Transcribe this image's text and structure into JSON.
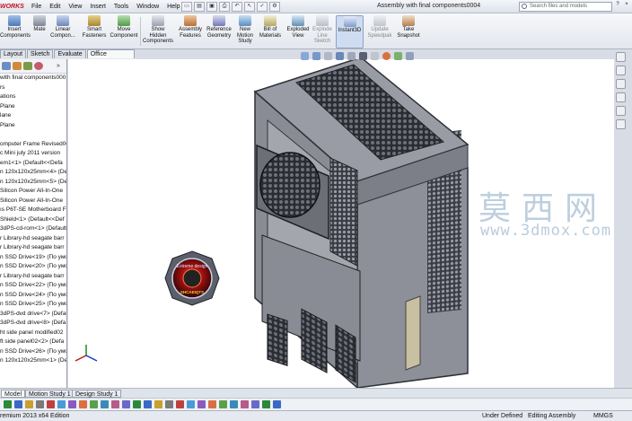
{
  "title_bar": {
    "logo": "WORKS",
    "menus": [
      "File",
      "Edit",
      "View",
      "Insert",
      "Tools",
      "Window",
      "Help"
    ],
    "document_title": "Assembly with final components0004",
    "search_placeholder": "Search files and models",
    "window_buttons": [
      "?",
      "×"
    ]
  },
  "command_manager": {
    "buttons": [
      {
        "label": "Insert\nComponents",
        "icon": "insert-components-icon",
        "enabled": true
      },
      {
        "label": "Mate",
        "icon": "mate-icon",
        "enabled": true
      },
      {
        "label": "Linear\nCompon...",
        "icon": "linear-pattern-icon",
        "enabled": true
      },
      {
        "label": "Smart\nFasteners",
        "icon": "smart-fasteners-icon",
        "enabled": true
      },
      {
        "label": "Move\nComponent",
        "icon": "move-component-icon",
        "enabled": true
      },
      {
        "label": "Show\nHidden\nComponents",
        "icon": "show-hidden-icon",
        "enabled": true
      },
      {
        "label": "Assembly\nFeatures",
        "icon": "assembly-features-icon",
        "enabled": true
      },
      {
        "label": "Reference\nGeometry",
        "icon": "reference-geometry-icon",
        "enabled": true
      },
      {
        "label": "New\nMotion\nStudy",
        "icon": "new-motion-study-icon",
        "enabled": true
      },
      {
        "label": "Bill of\nMaterials",
        "icon": "bill-of-materials-icon",
        "enabled": true
      },
      {
        "label": "Exploded\nView",
        "icon": "exploded-view-icon",
        "enabled": true
      },
      {
        "label": "Explode\nLine\nSketch",
        "icon": "explode-line-sketch-icon",
        "enabled": false
      },
      {
        "label": "Instant3D",
        "icon": "instant3d-icon",
        "enabled": true,
        "active": true
      },
      {
        "label": "Update\nSpeedpak",
        "icon": "update-speedpak-icon",
        "enabled": false
      },
      {
        "label": "Take\nSnapshot",
        "icon": "take-snapshot-icon",
        "enabled": true
      }
    ]
  },
  "tabs": [
    "Layout",
    "Sketch",
    "Evaluate",
    "Office Products"
  ],
  "active_tab": "Office Products",
  "feature_tree": {
    "tree_arrow": "»",
    "items": [
      "with final components000",
      "rs",
      "ations",
      "Plane",
      "lane",
      "Plane",
      "",
      "omputer Frame Revised000",
      "c Mini july 2011 version",
      "em1<1> (Default<<Defa",
      "n 120x120x25mm<4> (Def",
      "n 120x120x25mm<5> (Def",
      "Silicon Power All-In-One",
      "Silicon Power All-In-One",
      "ıs P6T-SE Motherboard F",
      "Shield<1> (Default<<Def",
      "3dPS-cd-rom<1> (Default",
      "r Library-hd seagate barr",
      "r Library-hd seagate barr",
      "n SSD Drive<19> (По умо",
      "n SSD Drive<20> (По умо",
      "r Library-hd seagate barr",
      "n SSD Drive<22> (По умо",
      "n SSD Drive<24> (По умо",
      "n SSD Drive<25> (По умо",
      "3dPS-dvd drive<7> (Default",
      "3dPS-dvd drive<8> (Defa",
      "ht side panel modified02",
      "ft side panel02<2> (Defa",
      "n SSD Drive<26> (По умо",
      "n 120x120x25mm<1> (Def"
    ]
  },
  "viewport": {
    "badge_text_top": "Extreme design",
    "badge_text_bottom": "SHCAEIQTS",
    "watermark_cn": "莫西网",
    "watermark_url": "www.3dmox.com",
    "triad_icon": "coordinate-triad-icon"
  },
  "bottom_tabs": [
    "Model",
    "Motion Study 1",
    "Design Study 1"
  ],
  "active_bottom_tab": "Model",
  "status_bar": {
    "edition": "remium 2013 x64 Edition",
    "state": "Under Defined",
    "mode": "Editing Assembly",
    "units": "MMGS"
  },
  "colors": {
    "accent": "#c4121c",
    "chassis_face": "#8d8f98",
    "chassis_edge": "#3a3c44",
    "toolbar_bg": "#eef1f5"
  }
}
